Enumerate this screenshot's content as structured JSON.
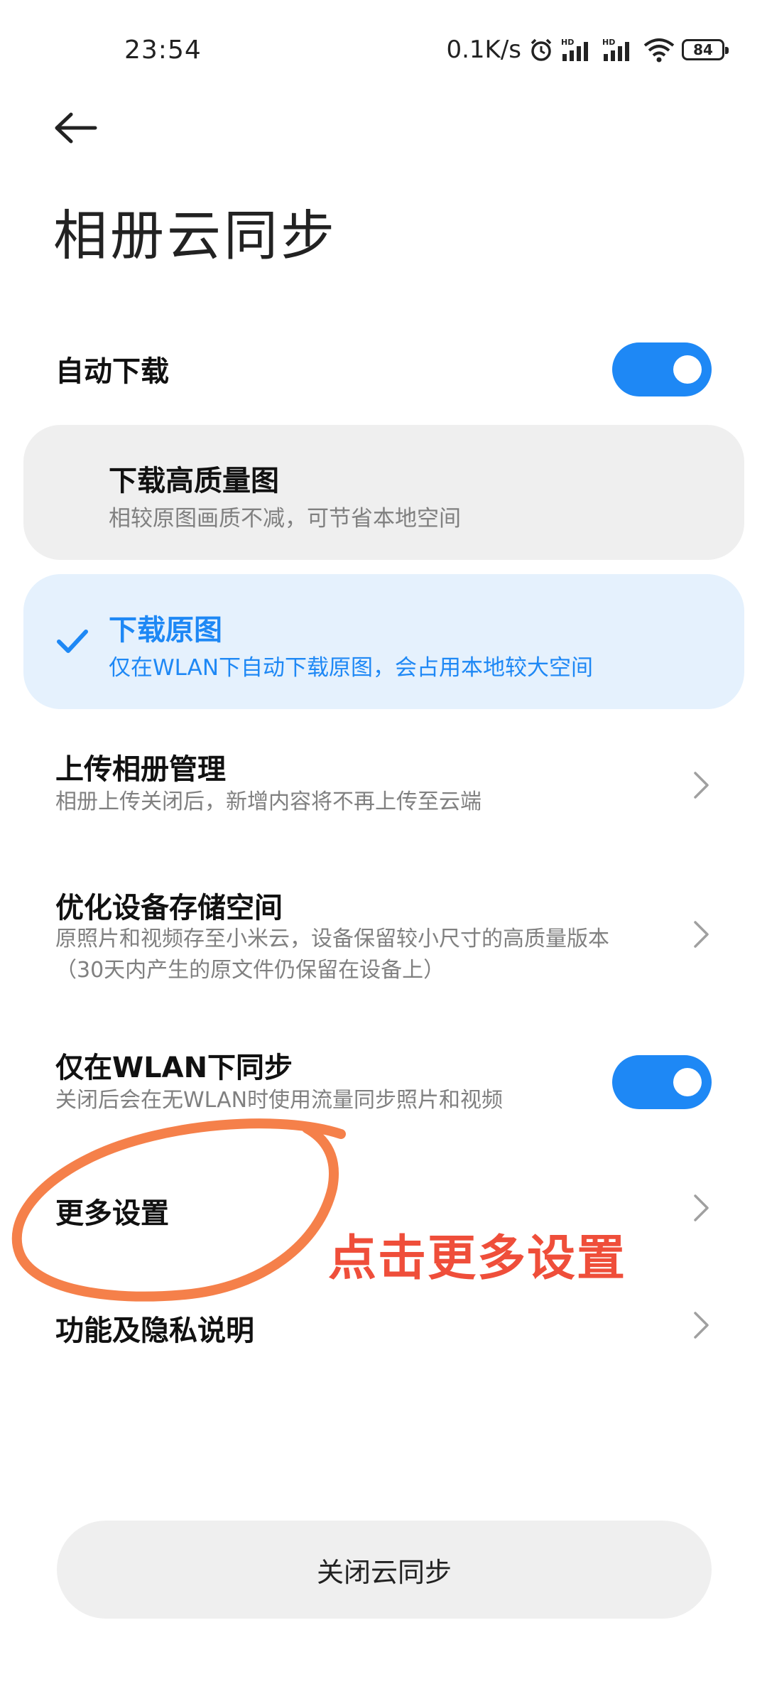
{
  "status_bar": {
    "time": "23:54",
    "net_speed": "0.1K/s",
    "battery": "84",
    "icons": [
      "alarm-icon",
      "hd-signal-icon",
      "hd-signal-icon",
      "wifi-icon",
      "battery-icon"
    ]
  },
  "header": {
    "title": "相册云同步"
  },
  "auto_download": {
    "label": "自动下载",
    "enabled": true
  },
  "download_options": [
    {
      "title": "下载高质量图",
      "subtitle": "相较原图画质不减，可节省本地空间",
      "selected": false
    },
    {
      "title": "下载原图",
      "subtitle": "仅在WLAN下自动下载原图，会占用本地较大空间",
      "selected": true
    }
  ],
  "upload_manage": {
    "title": "上传相册管理",
    "subtitle": "相册上传关闭后，新增内容将不再上传至云端"
  },
  "optimize_storage": {
    "title": "优化设备存储空间",
    "subtitle": "原照片和视频存至小米云，设备保留较小尺寸的高质量版本（30天内产生的原文件仍保留在设备上）"
  },
  "wlan_only": {
    "title": "仅在WLAN下同步",
    "subtitle": "关闭后会在无WLAN时使用流量同步照片和视频",
    "enabled": true
  },
  "more_settings": {
    "title": "更多设置"
  },
  "privacy": {
    "title": "功能及隐私说明"
  },
  "bottom_button": {
    "label": "关闭云同步"
  },
  "annotation": {
    "text": "点击更多设置",
    "color": "#ef4e3a",
    "ring_color": "#f5804a"
  },
  "colors": {
    "accent": "#1e88f5",
    "card_gray": "#efefef",
    "card_blue": "#e5f1fd"
  }
}
